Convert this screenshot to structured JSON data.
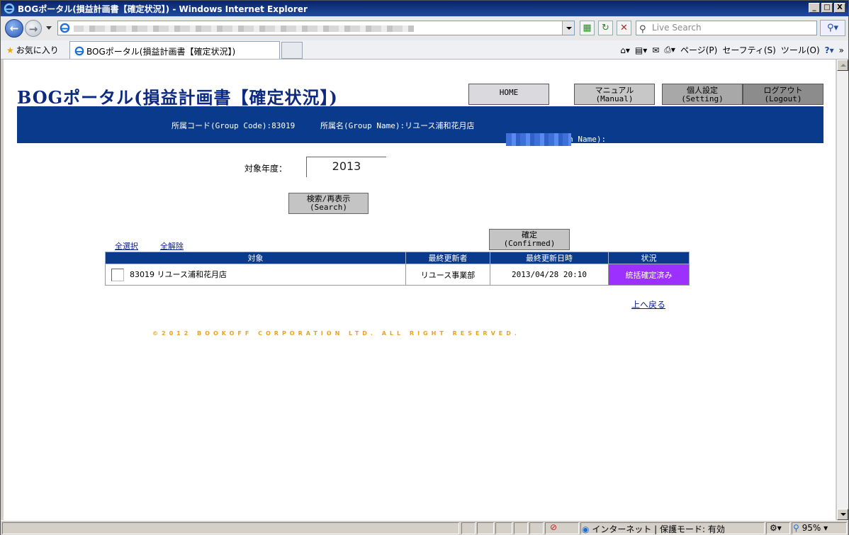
{
  "window": {
    "title": "BOGポータル(損益計画書【確定状況】) - Windows Internet Explorer",
    "controls": [
      "_",
      "□",
      "X"
    ]
  },
  "address": {
    "search_placeholder": "Live Search"
  },
  "command_bar": {
    "favorites": "お気に入り",
    "tab_title": "BOGポータル(損益計画書【確定状況】)",
    "page_menu": "ページ(P)",
    "safety_menu": "セーフティ(S)",
    "tools_menu": "ツール(O)",
    "more": "»"
  },
  "page": {
    "title": "BOGポータル(損益計画書【確定状況】)",
    "buttons": {
      "home": "HOME",
      "manual_jp": "マニュアル",
      "manual_en": "(Manual)",
      "setting_jp": "個人設定",
      "setting_en": "(Setting)",
      "logout_jp": "ログアウト",
      "logout_en": "(Logout)"
    },
    "info": {
      "group_code": "所属コード(Group Code):83019",
      "group_name": "所属名(Group Name):リユース浦和花月店",
      "login_label": "ログイン名(Login Name):"
    },
    "year_label": "対象年度：",
    "year_value": "2013",
    "search_jp": "検索/再表示",
    "search_en": "(Search)",
    "confirm_jp": "確定",
    "confirm_en": "(Confirmed)",
    "select_all": "全選択",
    "deselect_all": "全解除",
    "table": {
      "headers": [
        "対象",
        "最終更新者",
        "最終更新日時",
        "状況"
      ],
      "rows": [
        {
          "target": "83019 リユース浦和花月店",
          "updater": "リユース事業部",
          "updated_at": "2013/04/28 20:10",
          "status": "統括確定済み"
        }
      ]
    },
    "back_to_top": "上へ戻る",
    "copyright": "©2012 BOOKOFF CORPORATION LTD. ALL RIGHT RESERVED."
  },
  "status_bar": {
    "zone": "インターネット | 保護モード: 有効",
    "zoom": "95%"
  },
  "colors": {
    "accent": "#0a3a8c",
    "status_bg": "#9b30ff",
    "copyright": "#f0a020"
  }
}
